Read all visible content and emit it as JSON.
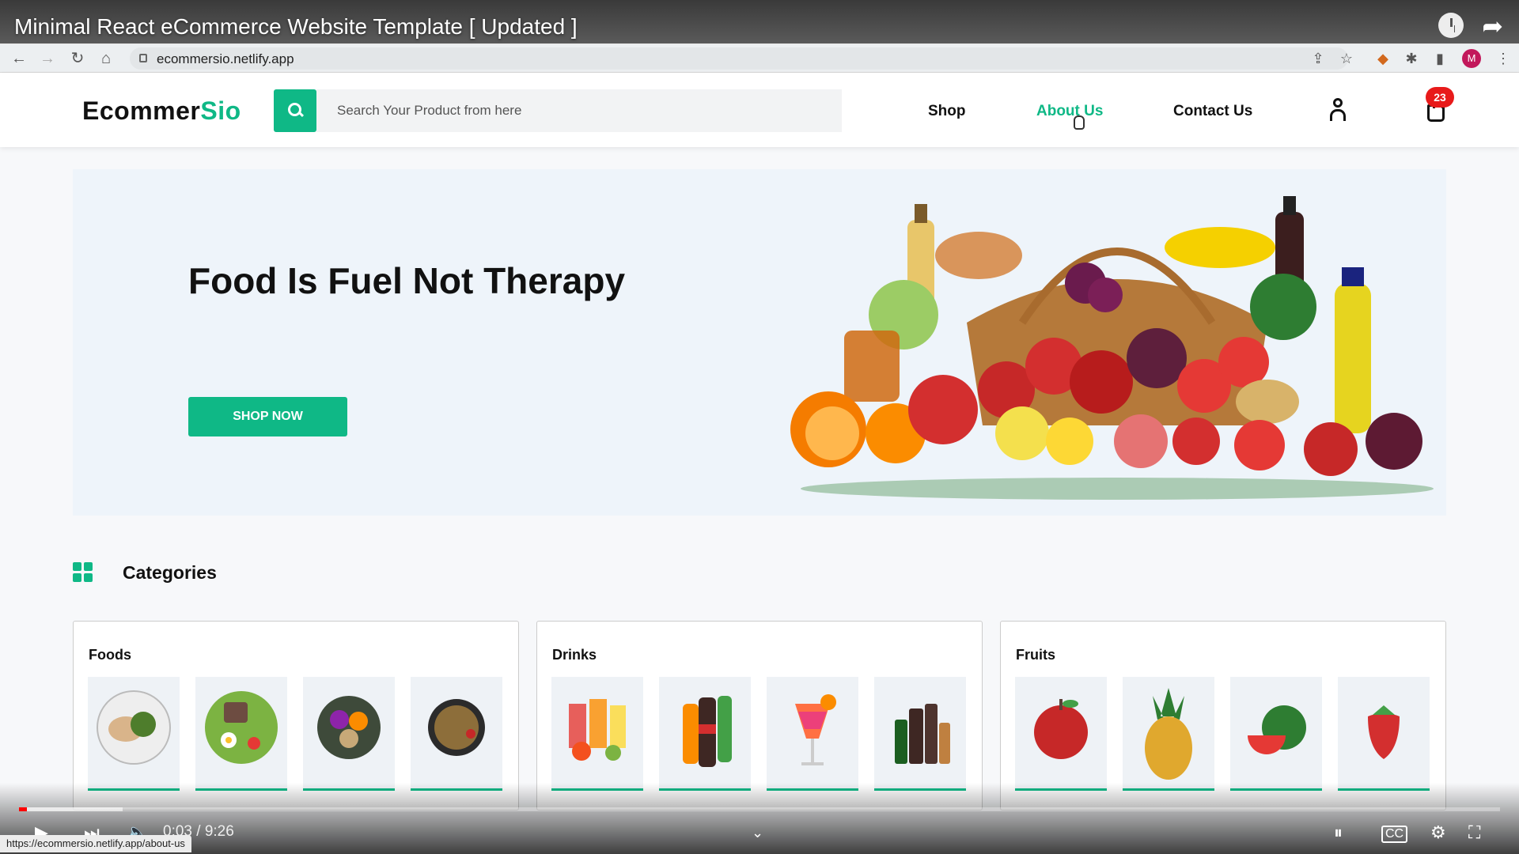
{
  "video": {
    "title": "Minimal React eCommerce Website Template [ Updated ]",
    "time": "0:03 / 9:26",
    "played_fraction": 0.003,
    "buffered_fraction": 0.07
  },
  "browser": {
    "url": "ecommersio.netlify.app",
    "status_url": "https://ecommersio.netlify.app/about-us",
    "profile_initial": "M"
  },
  "header": {
    "logo_main": "Ecommer",
    "logo_accent": "Sio",
    "search_placeholder": "Search Your Product from here",
    "nav": [
      "Shop",
      "About Us",
      "Contact Us"
    ],
    "active_nav": "About Us",
    "cart_count": "23"
  },
  "hero": {
    "title": "Food Is Fuel Not Therapy",
    "cta": "SHOP NOW"
  },
  "categories": {
    "title": "Categories",
    "cards": [
      {
        "name": "Foods",
        "items": [
          "chicken-salad-plate",
          "sandwich-egg-plate",
          "vegetable-bowl",
          "rice-dish-bowl"
        ]
      },
      {
        "name": "Drinks",
        "items": [
          "fruit-juices",
          "soda-bottles",
          "cocktail-glass",
          "liquor-bottles"
        ]
      },
      {
        "name": "Fruits",
        "items": [
          "apple",
          "pineapple",
          "watermelon",
          "strawberry"
        ]
      }
    ]
  },
  "colors": {
    "accent": "#0fb886",
    "badge": "#e81a1a",
    "hero_bg": "#eef4fa"
  }
}
